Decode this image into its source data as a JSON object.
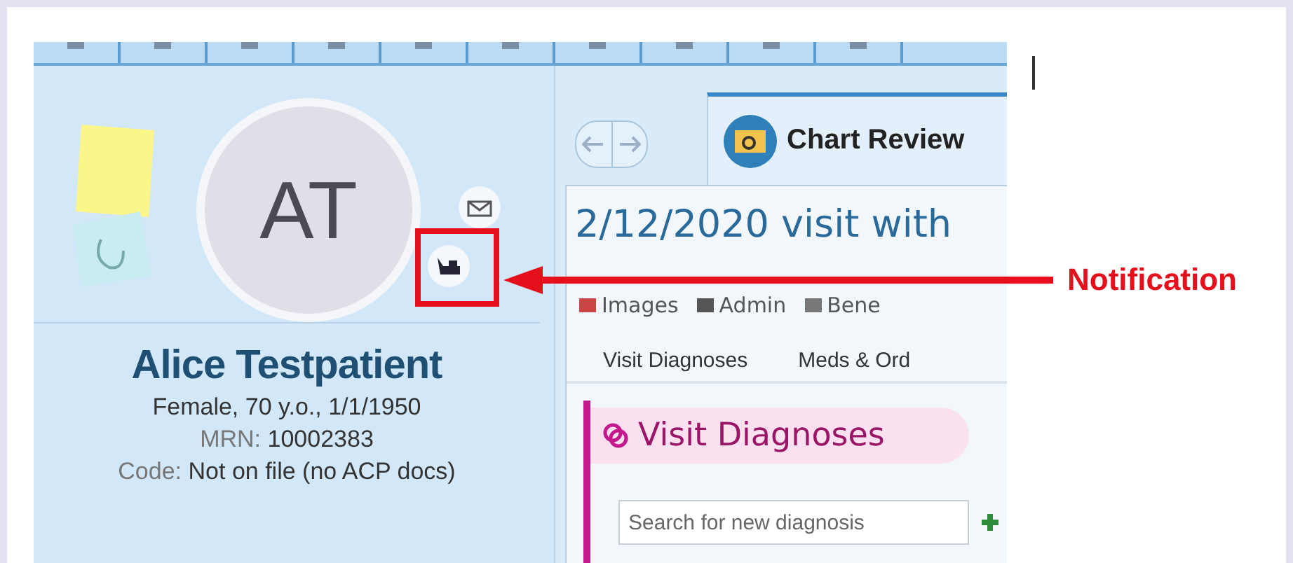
{
  "patient": {
    "initials": "AT",
    "name": "Alice Testpatient",
    "details": "Female, 70 y.o., 1/1/1950",
    "mrn_label": "MRN:",
    "mrn": "10002383",
    "code_label": "Code:",
    "code": "Not on file (no ACP docs)"
  },
  "activity_tab": {
    "label": "Chart Review",
    "selected": true
  },
  "visit_title": "2/12/2020 visit with",
  "toolbar_items": [
    "Images",
    "Admin",
    "Bene"
  ],
  "tabs": [
    "Visit Diagnoses",
    "Meds & Ord"
  ],
  "section": {
    "title": "Visit Diagnoses",
    "search_placeholder": "Search for new diagnosis"
  },
  "annotation": {
    "label": "Notification"
  }
}
